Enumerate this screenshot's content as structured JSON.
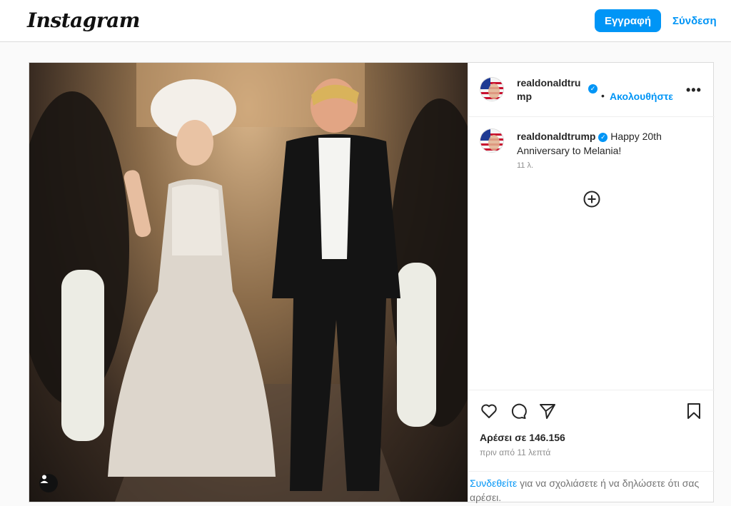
{
  "header": {
    "logo": "Instagram",
    "signup_label": "Εγγραφή",
    "login_label": "Σύνδεση"
  },
  "post": {
    "username": "realdonaldtrump",
    "follow_label": "Ακολουθήστε",
    "more_label": "•••",
    "caption_username": "realdonaldtrump",
    "caption_text": "Happy 20th Anniversary to Melania!",
    "caption_time": "11 λ.",
    "likes": "Αρέσει σε 146.156",
    "posted_ago": "πριν από 11 λεπτά",
    "login_prompt_link": "Συνδεθείτε",
    "login_prompt_text": "για να σχολιάσετε ή να δηλώσετε ότι σας αρέσει."
  },
  "colors": {
    "accent": "#0095f6",
    "border": "#dbdbdb"
  },
  "icons": [
    "heart-icon",
    "comment-icon",
    "share-icon",
    "bookmark-icon",
    "add-circle-icon",
    "user-tag-icon",
    "verified-badge-icon"
  ]
}
